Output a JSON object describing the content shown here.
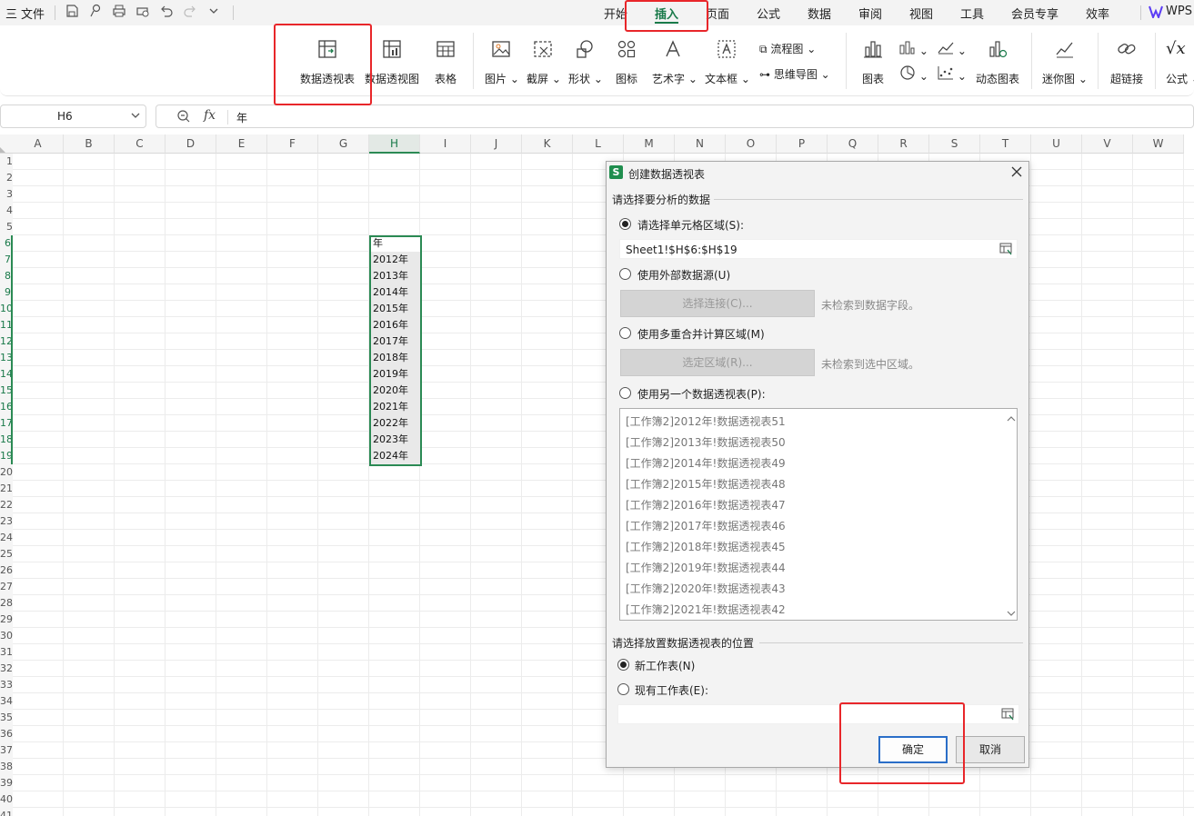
{
  "menubar": {
    "hamburger": "三",
    "file_label": "文件",
    "tabs": [
      "开始",
      "插入",
      "页面",
      "公式",
      "数据",
      "审阅",
      "视图",
      "工具",
      "会员专享",
      "效率"
    ],
    "brand": "WPS",
    "accent": "#1a7a4a"
  },
  "ribbon": {
    "pivot_table": "数据透视表",
    "pivot_chart": "数据透视图",
    "table": "表格",
    "picture": "图片",
    "screenshot": "截屏",
    "shapes": "形状",
    "icons": "图标",
    "wordart": "艺术字",
    "textbox": "文本框",
    "flowchart": "流程图",
    "mindmap": "思维导图",
    "chart": "图表",
    "dynamic_chart": "动态图表",
    "sparkline": "迷你图",
    "hyperlink": "超链接",
    "formula": "公式"
  },
  "formula_bar": {
    "name_box": "H6",
    "fx": "fx",
    "content": "年"
  },
  "grid": {
    "columns": [
      "A",
      "B",
      "C",
      "D",
      "E",
      "F",
      "G",
      "H",
      "I",
      "J",
      "K",
      "L",
      "M",
      "N",
      "O",
      "P",
      "Q",
      "R",
      "S",
      "T",
      "U",
      "V",
      "W"
    ],
    "selected_column": "H",
    "row_numbers": [
      "1",
      "2",
      "3",
      "4",
      "5",
      "6",
      "7",
      "8",
      "9",
      "10",
      "11",
      "12",
      "13",
      "14",
      "15",
      "16",
      "17",
      "18",
      "19",
      "20",
      "21",
      "22",
      "23",
      "24",
      "25",
      "26",
      "27",
      "28",
      "29",
      "30",
      "31",
      "32",
      "33",
      "34",
      "35",
      "36",
      "37",
      "38",
      "39",
      "40",
      "41"
    ],
    "h_values": [
      "年",
      "2012年",
      "2013年",
      "2014年",
      "2015年",
      "2016年",
      "2017年",
      "2018年",
      "2019年",
      "2020年",
      "2021年",
      "2022年",
      "2023年",
      "2024年"
    ]
  },
  "dialog": {
    "app_icon": "S",
    "title": "创建数据透视表",
    "section1": "请选择要分析的数据",
    "opt_range": "请选择单元格区域(S):",
    "range_value": "Sheet1!$H$6:$H$19",
    "opt_external": "使用外部数据源(U)",
    "btn_connect": "选择连接(C)...",
    "hint_connect": "未检索到数据字段。",
    "opt_multi": "使用多重合并计算区域(M)",
    "btn_region": "选定区域(R)...",
    "hint_region": "未检索到选中区域。",
    "opt_other": "使用另一个数据透视表(P):",
    "pivot_list": [
      "[工作簿2]2012年!数据透视表51",
      "[工作簿2]2013年!数据透视表50",
      "[工作簿2]2014年!数据透视表49",
      "[工作簿2]2015年!数据透视表48",
      "[工作簿2]2016年!数据透视表47",
      "[工作簿2]2017年!数据透视表46",
      "[工作簿2]2018年!数据透视表45",
      "[工作簿2]2019年!数据透视表44",
      "[工作簿2]2020年!数据透视表43",
      "[工作簿2]2021年!数据透视表42"
    ],
    "section2": "请选择放置数据透视表的位置",
    "opt_new_sheet": "新工作表(N)",
    "opt_existing": "现有工作表(E):",
    "existing_value": "",
    "ok": "确定",
    "cancel": "取消"
  },
  "highlight_color": "#e8262a"
}
